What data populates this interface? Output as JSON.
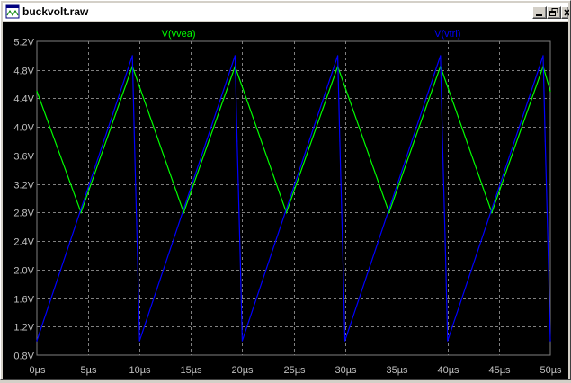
{
  "window": {
    "title": "buckvolt.raw",
    "icons": {
      "app": "waveform-file-icon",
      "minimize": "minimize-icon",
      "restore": "restore-icon",
      "close": "close-icon"
    }
  },
  "colors": {
    "background": "#000000",
    "grid": "#808080",
    "axis_text": "#c0c0c0",
    "vvea": "#00ff00",
    "vtri": "#0000ff",
    "overlap": "#00ffff"
  },
  "chart_data": {
    "type": "line",
    "xlabel": "",
    "ylabel": "",
    "grid": true,
    "legend": "top",
    "xlim": [
      0,
      50
    ],
    "ylim": [
      0.8,
      5.2
    ],
    "x_ticks": [
      0,
      5,
      10,
      15,
      20,
      25,
      30,
      35,
      40,
      45,
      50
    ],
    "x_tick_labels": [
      "0µs",
      "5µs",
      "10µs",
      "15µs",
      "20µs",
      "25µs",
      "30µs",
      "35µs",
      "40µs",
      "45µs",
      "50µs"
    ],
    "y_ticks": [
      0.8,
      1.2,
      1.6,
      2.0,
      2.4,
      2.8,
      3.2,
      3.6,
      4.0,
      4.4,
      4.8,
      5.2
    ],
    "y_tick_labels": [
      "0.8V",
      "1.2V",
      "1.6V",
      "2.0V",
      "2.4V",
      "2.8V",
      "3.2V",
      "3.6V",
      "4.0V",
      "4.4V",
      "4.8V",
      "5.2V"
    ],
    "series": [
      {
        "name": "V(vvea)",
        "color": "#00ff00",
        "x": [
          0,
          4.3,
          9.3,
          14.3,
          19.3,
          24.3,
          29.3,
          34.3,
          39.3,
          44.3,
          49.3,
          50
        ],
        "y": [
          4.5,
          2.8,
          4.85,
          2.8,
          4.85,
          2.8,
          4.85,
          2.8,
          4.85,
          2.8,
          4.85,
          4.5
        ]
      },
      {
        "name": "V(vtri)",
        "color": "#0000ff",
        "x": [
          0,
          9.3,
          9.5,
          9.8,
          10.0,
          19.3,
          19.5,
          19.8,
          20.0,
          29.3,
          29.5,
          29.8,
          30.0,
          39.3,
          39.5,
          39.8,
          40.0,
          49.3,
          49.5,
          49.8,
          50.0
        ],
        "y": [
          1.0,
          5.0,
          3.8,
          2.2,
          1.0,
          5.0,
          3.8,
          2.2,
          1.0,
          5.0,
          3.8,
          2.2,
          1.0,
          5.0,
          3.8,
          2.2,
          1.0,
          5.0,
          3.8,
          2.2,
          1.0
        ]
      }
    ]
  }
}
